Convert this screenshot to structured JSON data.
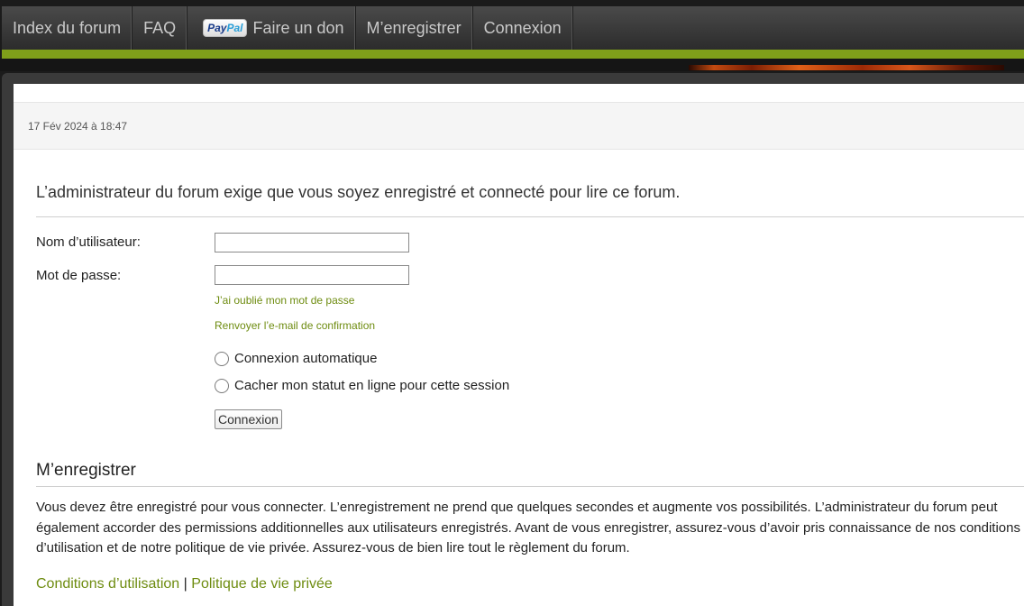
{
  "nav": {
    "items": [
      {
        "label": "Index du forum"
      },
      {
        "label": "FAQ"
      },
      {
        "label": "Faire un don",
        "logo": {
          "part1": "Pay",
          "part2": "Pal"
        }
      },
      {
        "label": "M’enregistrer"
      },
      {
        "label": "Connexion"
      }
    ]
  },
  "date": "17 Fév 2024 à 18:47",
  "login": {
    "title": "L’administrateur du forum exige que vous soyez enregistré et connecté pour lire ce forum.",
    "username_label": "Nom d’utilisateur:",
    "username_value": "",
    "password_label": "Mot de passe:",
    "password_value": "",
    "forgot_link": "J’ai oublié mon mot de passe",
    "resend_link": "Renvoyer l’e-mail de confirmation",
    "auto_login": "Connexion automatique",
    "hide_status": "Cacher mon statut en ligne pour cette session",
    "submit": "Connexion"
  },
  "register": {
    "title": "M’enregistrer",
    "text": "Vous devez être enregistré pour vous connecter. L’enregistrement ne prend que quelques secondes et augmente vos possibilités. L’administrateur du forum peut également accorder des permissions additionnelles aux utilisateurs enregistrés. Avant de vous enregistrer, assurez-vous d’avoir pris connaissance de nos conditions d’utilisation et de notre politique de vie privée. Assurez-vous de bien lire tout le règlement du forum.",
    "terms_link": "Conditions d’utilisation",
    "separator": "|",
    "privacy_link": "Politique de vie privée"
  },
  "colors": {
    "accent_green": "#7f9f1a",
    "link_green": "#6e8c10",
    "nav_text": "#c9c9c9"
  }
}
